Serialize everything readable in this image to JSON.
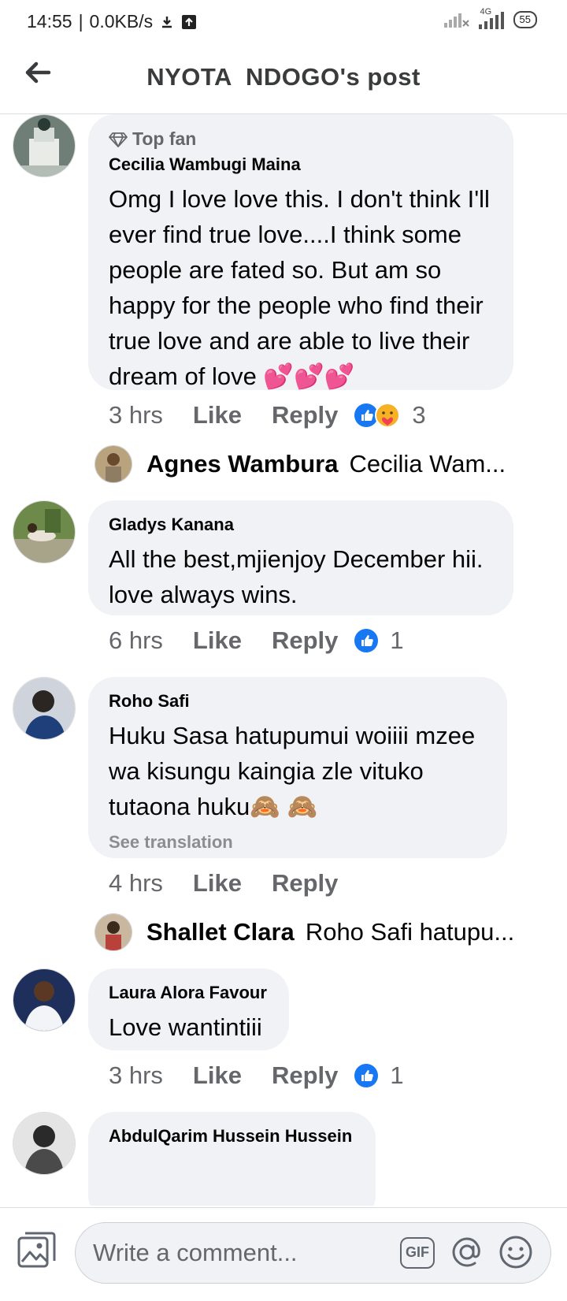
{
  "status_bar": {
    "time": "14:55",
    "speed": "0.0KB/s",
    "network": "4G",
    "battery": "55"
  },
  "header": {
    "title": "NYOTA  NDOGO's post",
    "back_icon": "arrow-left-icon"
  },
  "comments": [
    {
      "badge": "Top fan",
      "author": "Cecilia Wambugi Maina",
      "text": "Omg I love love this. I don't think I'll ever find true love....I think some people are fated so. But am so happy for the people who find their true love and are able to live their dream of love 💕💕💕",
      "time": "3 hrs",
      "like": "Like",
      "reply": "Reply",
      "reactions": [
        "like",
        "care"
      ],
      "reaction_count": "3",
      "reply_preview": {
        "author": "Agnes Wambura",
        "snippet": "Cecilia Wam..."
      }
    },
    {
      "author": "Gladys Kanana",
      "text": "All the best,mjienjoy December hii. love always wins.",
      "time": "6 hrs",
      "like": "Like",
      "reply": "Reply",
      "reactions": [
        "like"
      ],
      "reaction_count": "1"
    },
    {
      "author": "Roho Safi",
      "text": "Huku Sasa hatupumui woiiii mzee wa kisungu kaingia zle vituko tutaona huku🙈 🙈",
      "see_translation": "See translation",
      "time": "4 hrs",
      "like": "Like",
      "reply": "Reply",
      "reply_preview": {
        "author": "Shallet Clara",
        "snippet": "Roho Safi hatupu..."
      }
    },
    {
      "author": "Laura Alora Favour",
      "text": "Love wantintiii",
      "time": "3 hrs",
      "like": "Like",
      "reply": "Reply",
      "reactions": [
        "like"
      ],
      "reaction_count": "1"
    },
    {
      "author": "AbdulQarim Hussein Hussein"
    }
  ],
  "composer": {
    "placeholder": "Write a comment...",
    "gif": "GIF"
  },
  "colors": {
    "bubble": "#f0f2f5",
    "like_blue": "#1877f2",
    "secondary_text": "#65676b"
  }
}
